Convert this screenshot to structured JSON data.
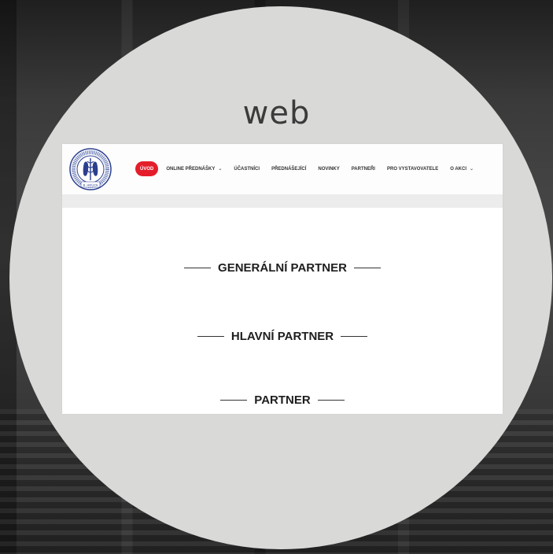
{
  "title": "web",
  "nav": {
    "items": [
      {
        "label": "ÚVOD",
        "active": true,
        "dropdown": false
      },
      {
        "label": "ONLINE PŘEDNÁŠKY",
        "active": false,
        "dropdown": true
      },
      {
        "label": "ÚČASTNÍCI",
        "active": false,
        "dropdown": false
      },
      {
        "label": "PŘEDNÁŠEJÍCÍ",
        "active": false,
        "dropdown": false
      },
      {
        "label": "NOVINKY",
        "active": false,
        "dropdown": false
      },
      {
        "label": "PARTNEŘI",
        "active": false,
        "dropdown": false
      },
      {
        "label": "PRO VYSTAVOVATELE",
        "active": false,
        "dropdown": false
      },
      {
        "label": "O AKCI",
        "active": false,
        "dropdown": true
      }
    ],
    "dropdown_icon": "chevron-down-icon",
    "active_color": "#e41d2b"
  },
  "logo": {
    "icon": "medical-feet-logo",
    "text_bottom": "B. HRÚZA"
  },
  "sections": {
    "general_partner": "GENERÁLNÍ PARTNER",
    "main_partner": "HLAVNÍ PARTNER",
    "partner": "PARTNER"
  }
}
